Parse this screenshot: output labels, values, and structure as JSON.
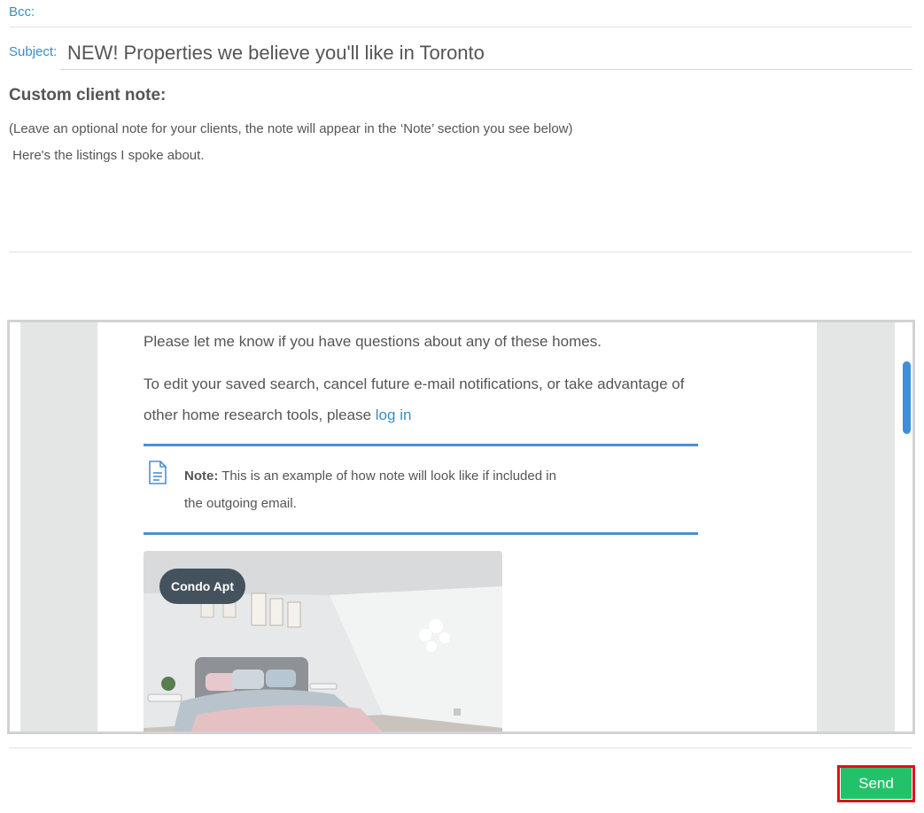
{
  "email": {
    "bcc_label": "Bcc:",
    "subject_label": "Subject:",
    "subject_value": "NEW! Properties we believe you'll like in Toronto"
  },
  "client_note": {
    "heading": "Custom client note:",
    "hint": "(Leave an optional note for your clients, the note will appear in the ‘Note’ section you see below)",
    "text": " Here's the listings I spoke about."
  },
  "preview": {
    "questions_line": "Please let me know if you have questions about any of these homes.",
    "edit_line_1": "To edit your saved search, cancel future e-mail notifications, or take advantage of",
    "edit_line_2": "other home research tools, please",
    "login_link": "log in",
    "note_label": "Note:",
    "note_text_1": "This is an example of how note will look like if included in",
    "note_text_2": "the outgoing email.",
    "listing_badge": "Condo Apt",
    "note_icon": "document-icon"
  },
  "actions": {
    "send_label": "Send"
  },
  "colors": {
    "link": "#3a8cc6",
    "rule": "#4e8fd1",
    "send": "#23c26a",
    "highlight": "#e0101b",
    "badge": "#44525e"
  }
}
